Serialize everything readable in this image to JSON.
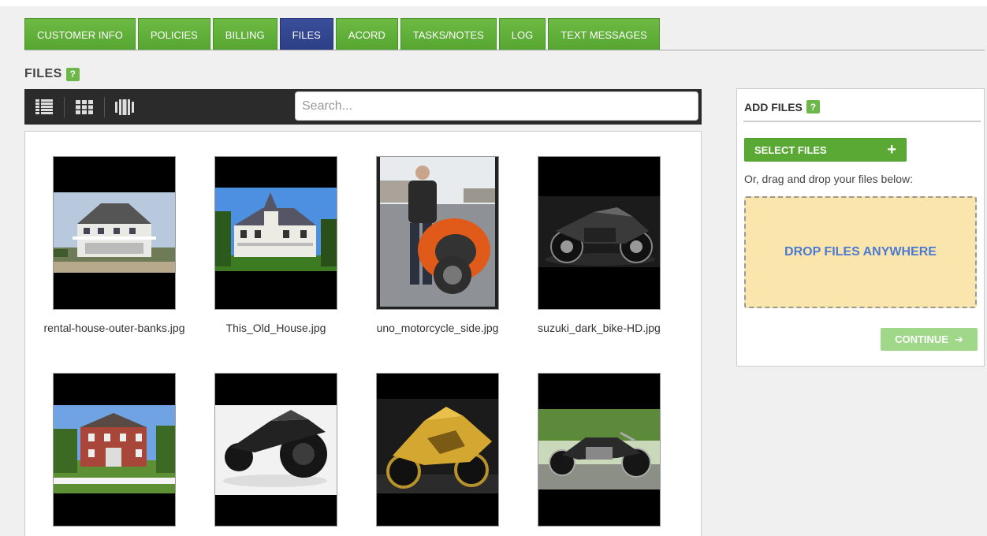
{
  "tabs": [
    {
      "label": "CUSTOMER INFO"
    },
    {
      "label": "POLICIES"
    },
    {
      "label": "BILLING"
    },
    {
      "label": "FILES",
      "active": true
    },
    {
      "label": "ACORD"
    },
    {
      "label": "TASKS/NOTES"
    },
    {
      "label": "LOG"
    },
    {
      "label": "TEXT MESSAGES"
    }
  ],
  "heading": {
    "title": "FILES",
    "help": "?"
  },
  "toolbar": {
    "views": [
      "list-view-icon",
      "grid-view-icon",
      "carousel-view-icon"
    ],
    "search_placeholder": "Search..."
  },
  "files": [
    {
      "name": "rental-house-outer-banks.jpg",
      "display": "rental-house-outer-banks.jpg"
    },
    {
      "name": "This_Old_House.jpg",
      "display": "This_Old_House.jpg"
    },
    {
      "name": "uno_motorcycle_side.jpg",
      "display": "uno_motorcycle_side.jpg"
    },
    {
      "name": "suzuki_dark_bike-HD.jpg",
      "display": "suzuki_dark_bike-HD.jpg"
    },
    {
      "name": "",
      "display": ""
    },
    {
      "name": "",
      "display": ""
    },
    {
      "name": "",
      "display": ""
    },
    {
      "name": "",
      "display": ""
    }
  ],
  "add_files": {
    "title": "ADD FILES",
    "help": "?",
    "select_label": "SELECT FILES",
    "select_icon": "+",
    "drag_hint": "Or, drag and drop your files below:",
    "drop_label": "DROP FILES ANYWHERE",
    "continue_label": "CONTINUE",
    "continue_icon": "➔"
  },
  "colors": {
    "tab_green": "#5aa935",
    "tab_active": "#2f4189",
    "drop_zone": "#fae6ad",
    "drop_text": "#4d7ad1",
    "continue": "#9fd888"
  }
}
